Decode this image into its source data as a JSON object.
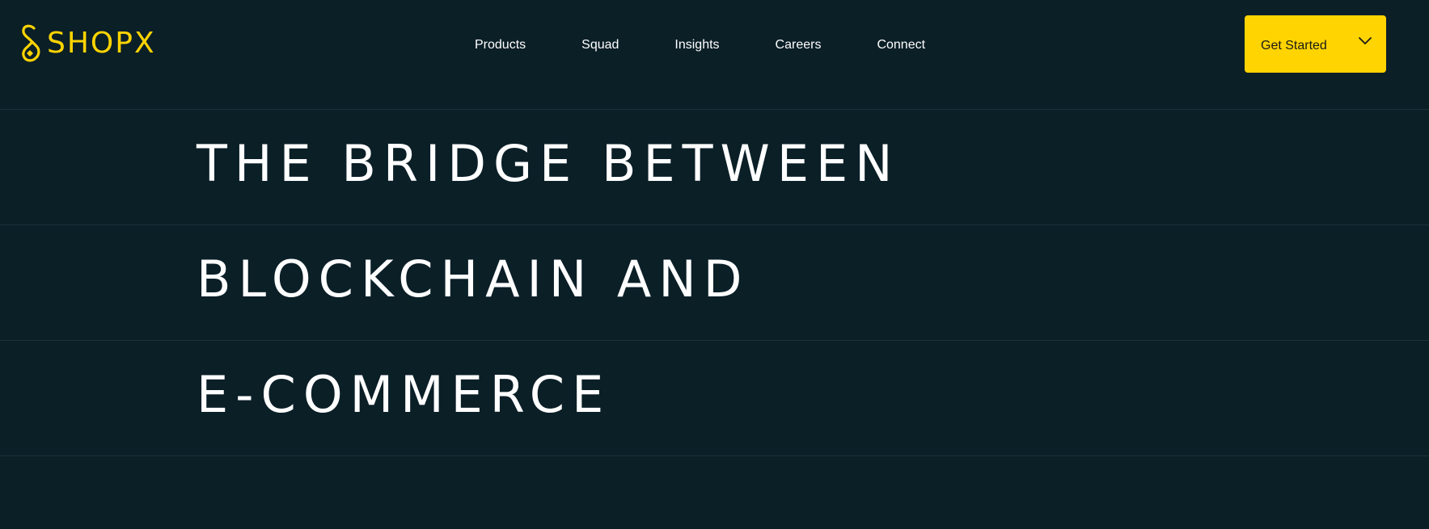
{
  "brand": {
    "name": "SHOPX",
    "accent_color": "#ffd400",
    "background_color": "#0b1f27",
    "logo_icon": "shopx-logo-icon"
  },
  "nav": {
    "items": [
      {
        "label": "Products"
      },
      {
        "label": "Squad"
      },
      {
        "label": "Insights"
      },
      {
        "label": "Careers"
      },
      {
        "label": "Connect"
      }
    ]
  },
  "cta": {
    "label": "Get Started",
    "icon": "chevron-down-icon"
  },
  "hero": {
    "lines": [
      "THE BRIDGE BETWEEN",
      "BLOCKCHAIN AND",
      "E-COMMERCE"
    ]
  }
}
